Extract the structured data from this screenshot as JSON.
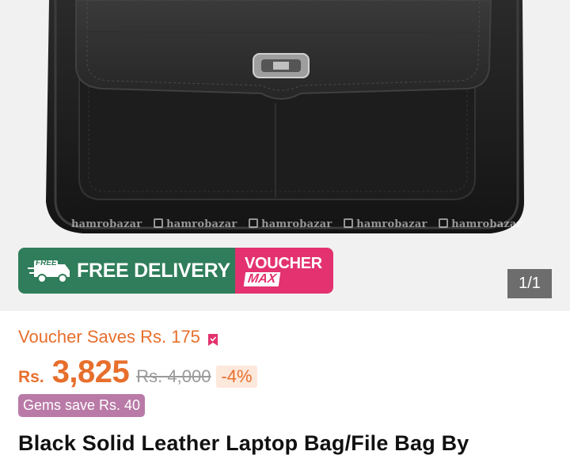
{
  "gallery": {
    "watermark_text": "hamrobazar",
    "counter": "1/1"
  },
  "banner": {
    "free_tag": "FREE",
    "free_delivery": "FREE DELIVERY",
    "voucher": "VOUCHER",
    "max": "MAX",
    "colors": {
      "delivery": "#2f7d5a",
      "voucher": "#e3326f"
    }
  },
  "pricing": {
    "voucher_saves": "Voucher Saves Rs. 175",
    "currency": "Rs.",
    "price": "3,825",
    "original_price": "Rs. 4,000",
    "discount": "-4%",
    "gems_save": "Gems save Rs. 40",
    "accent_color": "#e76f2c"
  },
  "product": {
    "title": "Black Solid Leather Laptop Bag/File Bag By"
  }
}
